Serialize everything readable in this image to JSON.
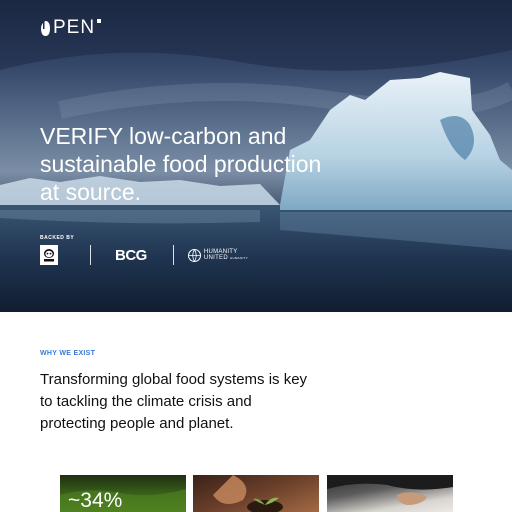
{
  "brand": {
    "logo_text": "PEN"
  },
  "hero": {
    "title": "VERIFY low-carbon and sustainable food production at source.",
    "backed_by_label": "BACKED BY",
    "partners": {
      "wwf": "WWF",
      "bcg": "BCG",
      "humanity_united_line1": "HUMANITY",
      "humanity_united_line2": "UNITED",
      "humanity_united_sub": "HUMANITY"
    }
  },
  "why_we_exist": {
    "label": "WHY WE EXIST",
    "body": "Transforming global food systems is key to tackling the climate crisis and protecting people and planet."
  },
  "cards": [
    {
      "stat": "~34%"
    },
    {
      "stat": ""
    },
    {
      "stat": ""
    }
  ],
  "colors": {
    "accent_label": "#3a7bd5",
    "hero_text": "#ffffff"
  }
}
